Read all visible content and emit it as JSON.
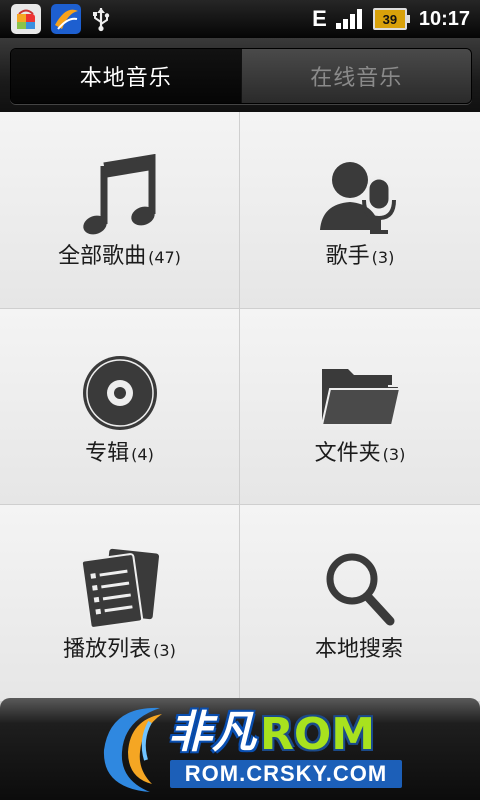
{
  "status_bar": {
    "left_icons": [
      "app-market-icon",
      "app-weather-icon",
      "usb-icon"
    ],
    "network_label": "E",
    "signal_bars": 4,
    "battery_level": "39",
    "time": "10:17"
  },
  "tabs": [
    {
      "label": "本地音乐",
      "active": true
    },
    {
      "label": "在线音乐",
      "active": false
    }
  ],
  "tiles": [
    {
      "label": "全部歌曲",
      "count": "(47)",
      "icon": "music-note-icon"
    },
    {
      "label": "歌手",
      "count": "(3)",
      "icon": "singer-microphone-icon"
    },
    {
      "label": "专辑",
      "count": "(4)",
      "icon": "album-disc-icon"
    },
    {
      "label": "文件夹",
      "count": "(3)",
      "icon": "folder-icon"
    },
    {
      "label": "播放列表",
      "count": "(3)",
      "icon": "playlist-icon"
    },
    {
      "label": "本地搜索",
      "count": "",
      "icon": "search-icon"
    }
  ],
  "watermark": {
    "title_cn": "非凡",
    "title_rom": "ROM",
    "url": "ROM.CRSKY.COM"
  }
}
